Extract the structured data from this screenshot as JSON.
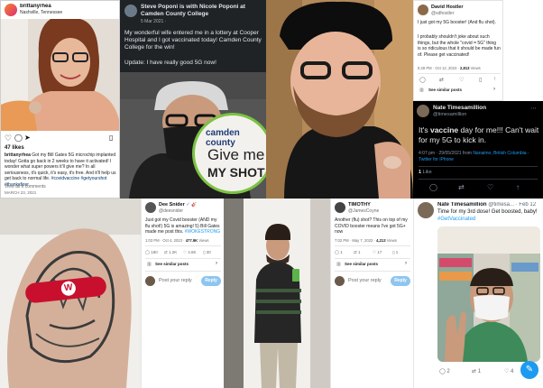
{
  "ig": {
    "username": "brittanyrhea",
    "location": "Nashville, Tennessee",
    "likes": "47 likes",
    "caption_user": "brittanyrhea",
    "caption": "Got my Bill Gates 5G microchip implanted today! Gotta go back in 2 weeks to have it activated! I wonder what super powers it'll give me? In all seriousness, it's quick, it's easy, it's free. And it'll help us get back to normal life.",
    "hashtags": "#covidvaccine #getyourshot #thanksfizer",
    "comments_link": "View all 6 comments",
    "date": "MARCH 23, 2021"
  },
  "fb": {
    "header": "Steve Poponi is with Nicole Poponi at Camden County College",
    "date": "5 Mar 2021 ·",
    "body": "My wonderful wife entered me in a lottery at Cooper Hospital and I got vaccinated today! Camden County College for the win!",
    "update": "Update: I have really good 5G now!",
    "sticker_top": "camden county",
    "sticker_line1": "Give me",
    "sticker_line2": "MY SHOT"
  },
  "dh": {
    "name": "David Hostler",
    "handle": "@sdhostler",
    "text1": "I just got my 5G booster! (And flu shot).",
    "text2": "I probably shouldn't joke about such things, but the whole \"covid = 5G\" thing is so ridiculous that it should be made fun of. Please get vaccinated!",
    "meta": "5:28 PM · Oct 12, 2023 · ",
    "views": "2,813",
    "views_label": " Views",
    "see_similar": "See similar posts"
  },
  "nt1": {
    "name": "Nate Timesamillion",
    "handle": "@timesamillion",
    "text_pre": "It's ",
    "text_bold": "vaccine",
    "text_post": " day for me!!! Can't wait for my 5G to kick in.",
    "meta_time": "4:07 pm · 29/05/2021 from ",
    "meta_place": "Nanaimo, British Columbia",
    "meta_sep": " · ",
    "meta_app": "Twitter for iPhone",
    "likes_count": "1",
    "likes_label": " Like"
  },
  "ds": {
    "name": "Dee Snider",
    "badge": "✓ 🎸",
    "handle": "@deesnider",
    "text": "Just got my Covid booster (AND my flu shot!) 5G is amazing! 5) Bill Gates made me post this.",
    "hashtag": "#WOKESTRONG",
    "meta": "1:03 PM · Oct 4, 2023 · ",
    "views": "477.9K",
    "views_label": " Views",
    "stats": [
      "180",
      "1.2K",
      "4.8K",
      "30"
    ],
    "see_similar": "See similar posts",
    "reply_placeholder": "Post your reply",
    "reply_button": "Reply"
  },
  "tm": {
    "name": "TIMOTHY",
    "handle": "@JamesCoyne",
    "text": "Another (flu) shot? This on top of my COVID booster means I've got 5G+ now",
    "meta": "7:02 PM · May 7, 2023 · ",
    "views": "4,213",
    "views_label": " Views",
    "stats": [
      "1",
      "1",
      "17",
      "1"
    ],
    "see_similar": "See similar posts",
    "reply_placeholder": "Post your reply",
    "reply_button": "Reply"
  },
  "nt2": {
    "name": "Nate Timesamillion",
    "handle": "@timesa...",
    "date": "Feb 12",
    "text": "Time for my 3rd dose! Get boosted, baby!",
    "hashtag": "#GetVaccinated",
    "stats": [
      "2",
      "1",
      "4"
    ]
  },
  "bandage": {
    "logo": "W"
  },
  "icons": [
    "verified-icon",
    "more-icon",
    "heart-icon",
    "comment-icon",
    "share-icon",
    "bookmark-icon",
    "retweet-icon",
    "chart-icon",
    "compose-icon"
  ],
  "colors": {
    "twitter_blue": "#1d9bf0",
    "dark_bg": "#15202b",
    "fb_dark": "#1f2326",
    "bandage_red": "#c8102e"
  }
}
